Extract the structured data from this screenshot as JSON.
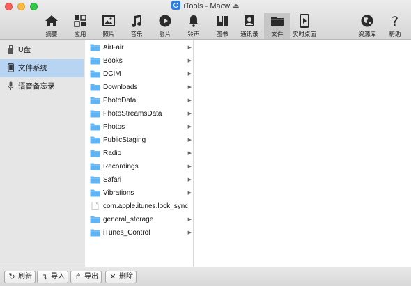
{
  "window": {
    "title": "iTools - Macw",
    "app_icon": "itools-logo-icon",
    "eject_icon": "eject-icon"
  },
  "toolbar": {
    "items": [
      {
        "label": "摘要",
        "icon": "home-icon"
      },
      {
        "label": "应用",
        "icon": "apps-grid-icon"
      },
      {
        "label": "照片",
        "icon": "photo-icon"
      },
      {
        "label": "音乐",
        "icon": "music-note-icon"
      },
      {
        "label": "影片",
        "icon": "play-circle-icon"
      },
      {
        "label": "铃声",
        "icon": "bell-icon"
      },
      {
        "label": "图书",
        "icon": "book-icon"
      },
      {
        "label": "通讯录",
        "icon": "contacts-icon"
      },
      {
        "label": "文件",
        "icon": "folder-icon",
        "active": true
      },
      {
        "label": "实时桌面",
        "icon": "realtime-desktop-icon"
      },
      {
        "label": "资源库",
        "icon": "globe-icon"
      },
      {
        "label": "帮助",
        "icon": "help-icon"
      }
    ]
  },
  "sidebar": {
    "items": [
      {
        "label": "U盘",
        "icon": "usb-drive-icon"
      },
      {
        "label": "文件系统",
        "icon": "phone-icon",
        "selected": true
      },
      {
        "label": "语音备忘录",
        "icon": "microphone-icon"
      }
    ]
  },
  "files": [
    {
      "name": "AirFair",
      "type": "folder"
    },
    {
      "name": "Books",
      "type": "folder"
    },
    {
      "name": "DCIM",
      "type": "folder"
    },
    {
      "name": "Downloads",
      "type": "folder"
    },
    {
      "name": "PhotoData",
      "type": "folder"
    },
    {
      "name": "PhotoStreamsData",
      "type": "folder"
    },
    {
      "name": "Photos",
      "type": "folder"
    },
    {
      "name": "PublicStaging",
      "type": "folder"
    },
    {
      "name": "Radio",
      "type": "folder"
    },
    {
      "name": "Recordings",
      "type": "folder"
    },
    {
      "name": "Safari",
      "type": "folder"
    },
    {
      "name": "Vibrations",
      "type": "folder"
    },
    {
      "name": "com.apple.itunes.lock_sync",
      "type": "file"
    },
    {
      "name": "general_storage",
      "type": "folder"
    },
    {
      "name": "iTunes_Control",
      "type": "folder"
    }
  ],
  "bottombar": {
    "refresh_label": "刷新",
    "import_label": "导入",
    "export_label": "导出",
    "delete_label": "删除"
  },
  "colors": {
    "folder_blue": "#5fb4f5",
    "selection": "#b7d4f2",
    "toolbar_active": "#c6c6c6"
  }
}
